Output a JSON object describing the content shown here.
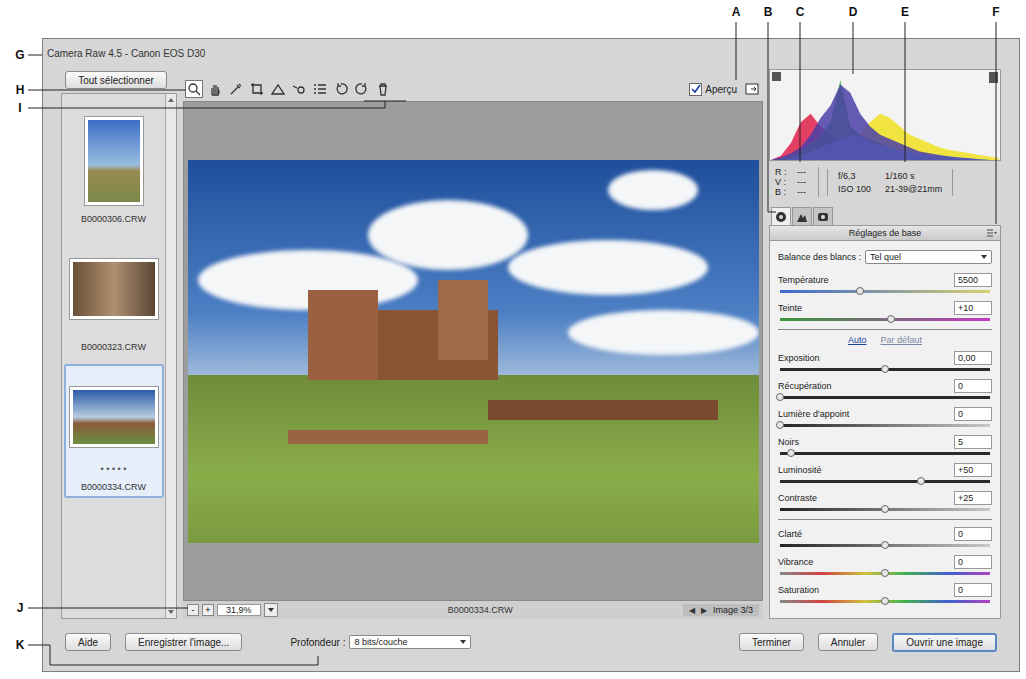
{
  "callouts": [
    {
      "label": "A"
    },
    {
      "label": "B"
    },
    {
      "label": "C"
    },
    {
      "label": "D"
    },
    {
      "label": "E"
    },
    {
      "label": "F"
    },
    {
      "label": "G"
    },
    {
      "label": "H"
    },
    {
      "label": "I"
    },
    {
      "label": "J"
    },
    {
      "label": "K"
    }
  ],
  "window": {
    "title": "Camera Raw 4.5 - Canon EOS D30"
  },
  "filmstrip": {
    "select_all": "Tout sélectionner",
    "items": [
      {
        "name": "B0000306.CRW",
        "selected": false,
        "rating": ""
      },
      {
        "name": "B0000323.CRW",
        "selected": false,
        "rating": ""
      },
      {
        "name": "B0000334.CRW",
        "selected": true,
        "rating": "• • • • •"
      }
    ]
  },
  "toolbar": {
    "tools": [
      {
        "selected": true
      },
      {
        "selected": false
      },
      {
        "selected": false
      },
      {
        "selected": false
      },
      {
        "selected": false
      },
      {
        "selected": false
      },
      {
        "selected": false
      },
      {
        "selected": false
      },
      {
        "selected": false
      },
      {
        "selected": false
      }
    ],
    "preview": {
      "label": "Aperçu",
      "checked": true
    }
  },
  "preview": {
    "filename": "B0000334.CRW",
    "zoom_out": "-",
    "zoom_in": "+",
    "zoom": "31,9%",
    "prev": "◀",
    "next": "▶",
    "counter": "Image 3/3"
  },
  "histogram": {
    "series": [
      {
        "color": "#f0e020",
        "values": [
          0,
          0,
          1,
          2,
          4,
          6,
          10,
          15,
          20,
          30,
          45,
          55,
          50,
          40,
          30,
          25,
          20,
          15,
          12,
          10,
          8,
          6,
          4,
          2
        ]
      },
      {
        "color": "#e0204a",
        "values": [
          0,
          5,
          20,
          45,
          55,
          40,
          30,
          25,
          20,
          15,
          12,
          10,
          8,
          6,
          5,
          4,
          3,
          2,
          2,
          1,
          1,
          0,
          0,
          0
        ]
      },
      {
        "color": "#3cb043",
        "values": [
          0,
          2,
          5,
          10,
          20,
          30,
          45,
          95,
          40,
          30,
          25,
          20,
          15,
          10,
          8,
          6,
          5,
          4,
          3,
          2,
          1,
          1,
          0,
          0
        ]
      },
      {
        "color": "#7fd3e0",
        "values": [
          0,
          0,
          2,
          5,
          10,
          15,
          20,
          25,
          30,
          28,
          22,
          18,
          15,
          12,
          10,
          8,
          6,
          5,
          4,
          3,
          2,
          1,
          0,
          0
        ]
      },
      {
        "color": "#4b3fa8",
        "values": [
          0,
          3,
          8,
          15,
          30,
          50,
          65,
          90,
          80,
          55,
          40,
          30,
          25,
          20,
          15,
          10,
          8,
          6,
          4,
          3,
          2,
          1,
          0,
          0
        ]
      }
    ]
  },
  "readout": {
    "channels": [
      {
        "label": "R :",
        "value": "---"
      },
      {
        "label": "V :",
        "value": "---"
      },
      {
        "label": "B :",
        "value": "---"
      }
    ],
    "exif": [
      "f/6,3",
      "1/160 s",
      "ISO 100",
      "21-39@21mm"
    ]
  },
  "panel": {
    "tabs": [
      {
        "selected": true
      },
      {
        "selected": false
      },
      {
        "selected": false
      }
    ],
    "title": "Réglages de base"
  },
  "white_balance": {
    "label": "Balance des blancs :",
    "value": "Tel quel",
    "sliders": [
      {
        "name": "Température",
        "value": "5500",
        "level": 0.38,
        "kind": "temperature"
      },
      {
        "name": "Teinte",
        "value": "+10",
        "level": 0.53,
        "kind": "tint"
      }
    ]
  },
  "tone": {
    "auto": "Auto",
    "default": "Par défaut",
    "sliders": [
      {
        "name": "Exposition",
        "value": "0,00",
        "level": 0.5,
        "kind": "plain"
      },
      {
        "name": "Récupération",
        "value": "0",
        "level": 0.0,
        "kind": "plain"
      },
      {
        "name": "Lumière d'appoint",
        "value": "0",
        "level": 0.0,
        "kind": "clarity"
      },
      {
        "name": "Noirs",
        "value": "5",
        "level": 0.05,
        "kind": "plain"
      },
      {
        "name": "Luminosité",
        "value": "+50",
        "level": 0.67,
        "kind": "plain"
      },
      {
        "name": "Contraste",
        "value": "+25",
        "level": 0.5,
        "kind": "clarity"
      }
    ]
  },
  "presence": {
    "sliders": [
      {
        "name": "Clarté",
        "value": "0",
        "level": 0.5,
        "kind": "clarity"
      },
      {
        "name": "Vibrance",
        "value": "0",
        "level": 0.5,
        "kind": "color"
      },
      {
        "name": "Saturation",
        "value": "0",
        "level": 0.5,
        "kind": "color"
      }
    ]
  },
  "bottom": {
    "help": "Aide",
    "save": "Enregistrer l'image...",
    "depth_label": "Profondeur :",
    "depth": "8 bits/couche",
    "done": "Terminer",
    "cancel": "Annuler",
    "open": "Ouvrir une image"
  }
}
